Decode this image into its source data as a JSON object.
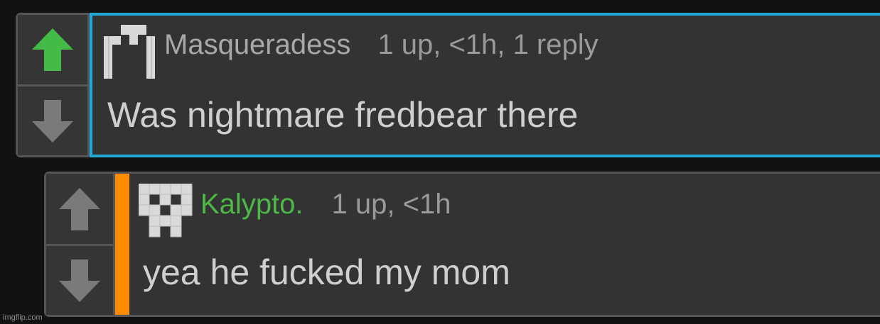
{
  "comments": [
    {
      "username": "Masqueradess",
      "meta": "1 up, <1h, 1 reply",
      "text": "Was nightmare fredbear there",
      "upvoted": true
    },
    {
      "username": "Kalypto.",
      "meta": "1 up, <1h",
      "text": "yea he fucked my mom",
      "upvoted": false
    }
  ],
  "watermark": "imgflip.com",
  "colors": {
    "upvote_active": "#45bb47",
    "vote_inactive": "#7a7a7a",
    "selected_border": "#1fa8d8",
    "reply_depth_bar": "#ff8c00",
    "username_green": "#4cb848"
  },
  "icons": {
    "up": "arrow-up-icon",
    "down": "arrow-down-icon"
  }
}
